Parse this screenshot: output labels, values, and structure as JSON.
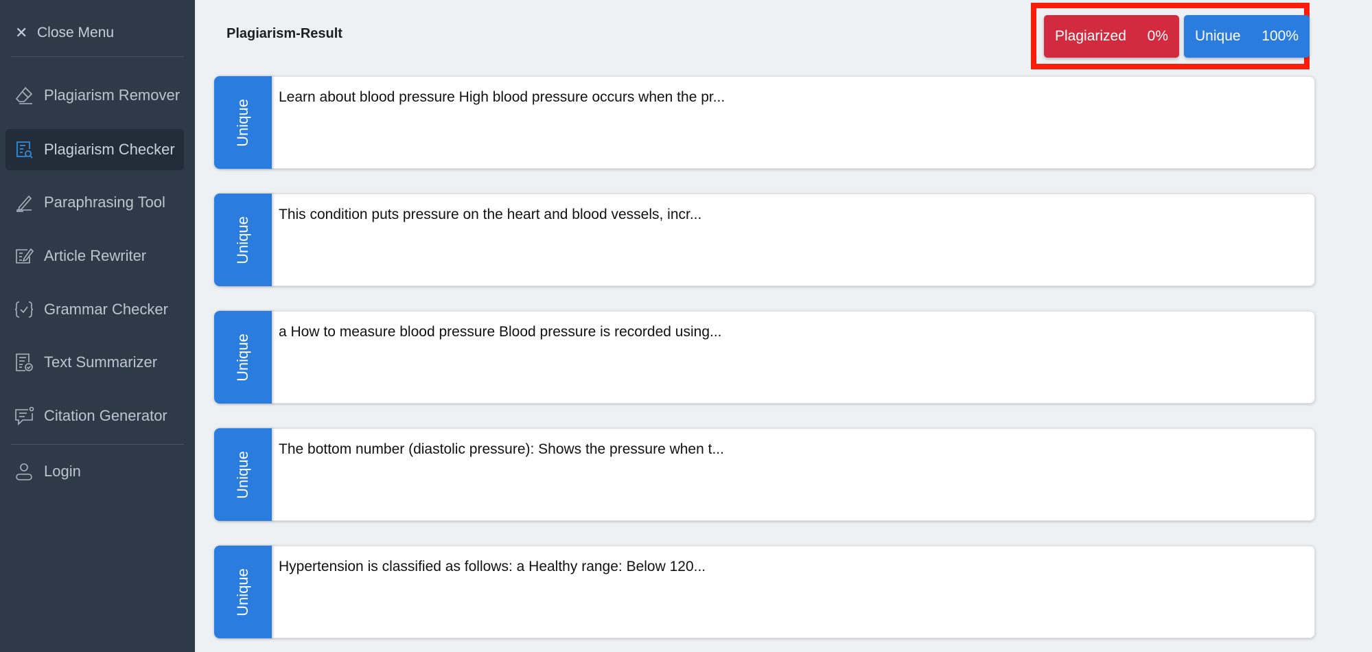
{
  "sidebar": {
    "close_label": "Close Menu",
    "items": [
      {
        "label": "Plagiarism Remover",
        "icon": "eraser-icon",
        "active": false
      },
      {
        "label": "Plagiarism Checker",
        "icon": "document-search-icon",
        "active": true
      },
      {
        "label": "Paraphrasing Tool",
        "icon": "pencil-icon",
        "active": false
      },
      {
        "label": "Article Rewriter",
        "icon": "edit-document-icon",
        "active": false
      },
      {
        "label": "Grammar Checker",
        "icon": "braces-check-icon",
        "active": false
      },
      {
        "label": "Text Summarizer",
        "icon": "document-check-icon",
        "active": false
      },
      {
        "label": "Citation Generator",
        "icon": "message-quote-icon",
        "active": false
      }
    ],
    "login_label": "Login"
  },
  "header": {
    "title": "Plagiarism-Result",
    "plagiarized_label": "Plagiarized",
    "plagiarized_value": "0%",
    "unique_label": "Unique",
    "unique_value": "100%"
  },
  "results": [
    {
      "status": "Unique",
      "text": "Learn about blood pressure High blood pressure occurs when the pr..."
    },
    {
      "status": "Unique",
      "text": "This condition puts pressure on the heart and blood vessels, incr..."
    },
    {
      "status": "Unique",
      "text": "a How to measure blood pressure Blood pressure is recorded using..."
    },
    {
      "status": "Unique",
      "text": "The bottom number (diastolic pressure): Shows the pressure when t..."
    },
    {
      "status": "Unique",
      "text": "Hypertension is classified as follows: a Healthy range: Below 120..."
    }
  ],
  "colors": {
    "sidebar_bg": "#2e3a47",
    "accent_blue": "#2a7ddf",
    "plagiarized_red": "#d22a3f",
    "highlight_red": "#ff1d0a"
  }
}
